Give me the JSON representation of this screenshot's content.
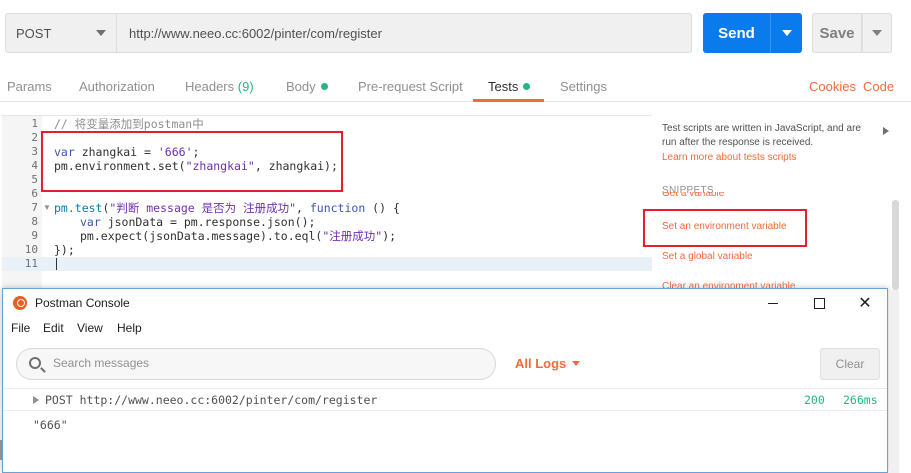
{
  "request": {
    "method": "POST",
    "url": "http://www.neeo.cc:6002/pinter/com/register",
    "send_label": "Send",
    "save_label": "Save"
  },
  "tabs": [
    {
      "label": "Params"
    },
    {
      "label": "Authorization"
    },
    {
      "label": "Headers",
      "count": "(9)"
    },
    {
      "label": "Body",
      "dot": true
    },
    {
      "label": "Pre-request Script"
    },
    {
      "label": "Tests",
      "dot": true,
      "active": true
    },
    {
      "label": "Settings"
    }
  ],
  "links": {
    "cookies": "Cookies",
    "code": "Code"
  },
  "editor": {
    "line_numbers": [
      "1",
      "2",
      "3",
      "4",
      "5",
      "6",
      "7",
      "8",
      "9",
      "10",
      "11"
    ],
    "lines": {
      "l1": "// 将变量添加到postman中",
      "l3_kw": "var",
      "l3_rest": " zhangkai = ",
      "l3_str": "'666'",
      "l3_end": ";",
      "l4_a": "pm.environment.set(",
      "l4_str": "\"zhangkai\"",
      "l4_b": ", zhangkai);",
      "l7_fn": "pm.test",
      "l7_a": "(",
      "l7_str": "\"判断 message 是否为 注册成功\"",
      "l7_b": ", ",
      "l7_kw": "function",
      "l7_c": " () {",
      "l8_kw": "var",
      "l8_rest": " jsonData = pm.response.json();",
      "l9_a": "pm.expect(jsonData.message).to.eql(",
      "l9_str": "\"注册成功\"",
      "l9_b": ");",
      "l10": "});"
    }
  },
  "help": {
    "text": "Test scripts are written in JavaScript, and are run after the response is received.",
    "link": "Learn more about tests scripts",
    "snippets_title": "SNIPPETS",
    "snippets": [
      "Get a variable",
      "Set an environment variable",
      "Set a global variable",
      "Clear an environment variable"
    ]
  },
  "console": {
    "title": "Postman Console",
    "menu": [
      "File",
      "Edit",
      "View",
      "Help"
    ],
    "search_placeholder": "Search messages",
    "filter_label": "All Logs",
    "clear_label": "Clear",
    "log": {
      "request": "POST http://www.neeo.cc:6002/pinter/com/register",
      "status": "200",
      "time": "266ms",
      "value": "\"666\""
    }
  },
  "colors": {
    "accent": "#f26b3a",
    "send_blue": "#097bed",
    "success_green": "#26b47f",
    "highlight_red": "#e0202a"
  }
}
